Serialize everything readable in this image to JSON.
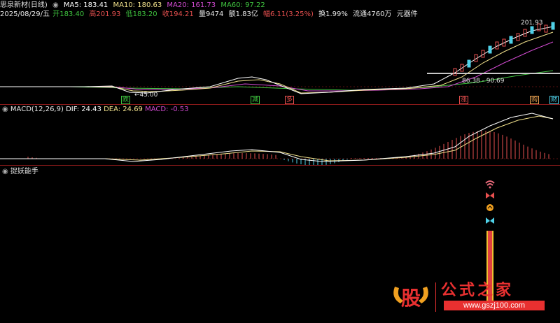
{
  "header": {
    "stock_name": "思泉新材(日线)",
    "ma5": "MA5: 183.41",
    "ma10": "MA10: 180.63",
    "ma20": "MA20: 161.73",
    "ma60": "MA60: 97.22",
    "date": "2025/08/29/五",
    "open": "开183.40",
    "high": "高201.93",
    "low": "低183.20",
    "close": "收194.21",
    "volume": "量9474",
    "amount": "额1.83亿",
    "change": "幅6.11(3.25%)",
    "turnover": "换1.99%",
    "float": "流通4760万",
    "sector": "元器件"
  },
  "price_pane": {
    "high_label": "201.93",
    "low_label": "45.00",
    "range_label": "86.38 - 90.69",
    "signals": [
      "跌",
      "减",
      "多",
      "涨",
      "购",
      "财"
    ]
  },
  "macd_pane": {
    "name": "MACD(12,26,9)",
    "dif": "DIF: 24.43",
    "dea": "DEA: 24.69",
    "macd": "MACD: -0.53"
  },
  "indicator_pane": {
    "name": "捉妖能手"
  },
  "watermark": {
    "logo_char": "股",
    "site_name": "公式之家",
    "url": "www.gszj100.com"
  },
  "colors": {
    "up": "#e8504f",
    "down": "#4fd1e8",
    "ma5": "#ffffff",
    "ma10": "#f2e28c",
    "ma20": "#d24bd2",
    "ma60": "#3fc43f",
    "grid_red": "#8a1a1a"
  }
}
